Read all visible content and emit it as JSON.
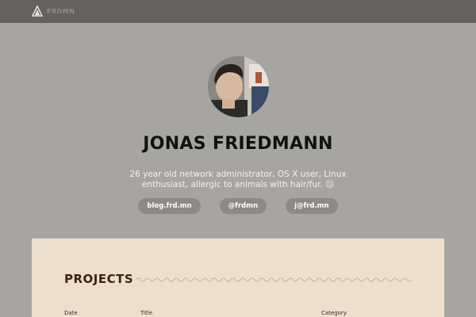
{
  "header": {
    "brand_text": "FRDMN",
    "brand_logo_icon": "triangle-logo-icon"
  },
  "profile": {
    "name": "JONAS FRIEDMANN",
    "bio": "26 year old network administrator, OS X user, Linux enthusiast, allergic to animals with hair/fur. ☹",
    "links": [
      {
        "label": "blog.frd.mn"
      },
      {
        "label": "@frdmn"
      },
      {
        "label": "j@frd.mn"
      }
    ]
  },
  "projects": {
    "title": "PROJECTS",
    "columns": [
      "Date",
      "Title",
      "Category"
    ]
  },
  "colors": {
    "topbar": "#64615e",
    "background": "#a7a5a1",
    "card": "#ecdfcd",
    "pill": "#8d8a86",
    "section_title": "#3a2414"
  }
}
